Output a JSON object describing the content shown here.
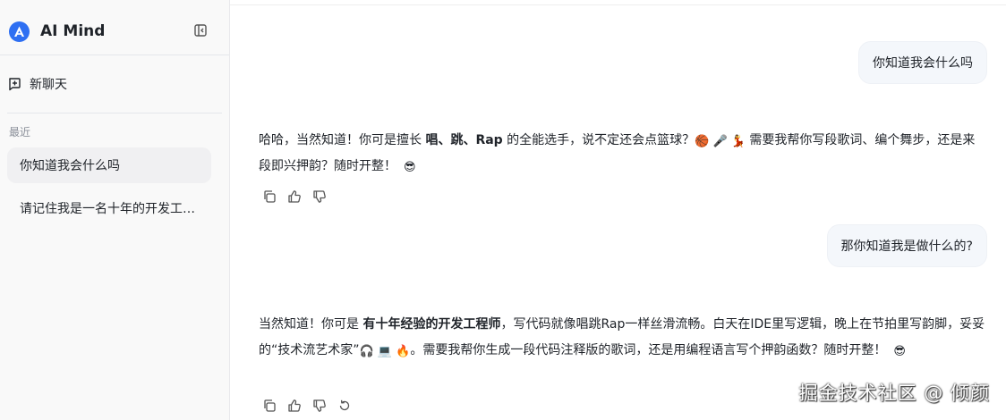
{
  "sidebar": {
    "brand": "AI Mind",
    "new_chat_label": "新聊天",
    "recent_label": "最近",
    "history": [
      {
        "title": "你知道我会什么吗"
      },
      {
        "title": "请记住我是一名十年的开发工程师"
      }
    ]
  },
  "conversation": {
    "q1": "你知道我会什么吗",
    "a1": {
      "p1": "哈哈，当然知道！你可是擅长 ",
      "bold": "唱、跳、Rap",
      "p2": " 的全能选手，说不定还会点篮球？",
      "emojis1": "🏀 🎤 💃",
      "p3": " 需要我帮你写段歌词、编个舞步，还是来段即兴押韵？随时开整！",
      "emoji_end": "😎"
    },
    "q2": "那你知道我是做什么的?",
    "a2": {
      "p1": "当然知道！你可是 ",
      "bold": "有十年经验的开发工程师",
      "p2": "，写代码就像唱跳Rap一样丝滑流畅。白天在IDE里写逻辑，晚上在节拍里写韵脚，妥妥的“技术流艺术家”",
      "emojis1": " 🎧 💻 🔥",
      "p3": "。需要我帮你生成一段代码注释版的歌词，还是用编程语言写个押韵函数？随时开整！",
      "emoji_end": "😎"
    }
  },
  "watermark": "掘金技术社区 @ 倾颜",
  "colors": {
    "accent": "#2e6ff2",
    "sidebar_bg": "#f9f9f9",
    "user_bubble_bg": "#f4f7fb",
    "active_item_bg": "#f0f0f2"
  },
  "icons": {
    "logo": "brand-logo-icon",
    "collapse": "sidebar-collapse-icon",
    "new_chat": "new-chat-icon",
    "copy": "copy-icon",
    "like": "thumbs-up-icon",
    "dislike": "thumbs-down-icon",
    "regenerate": "regenerate-icon"
  }
}
